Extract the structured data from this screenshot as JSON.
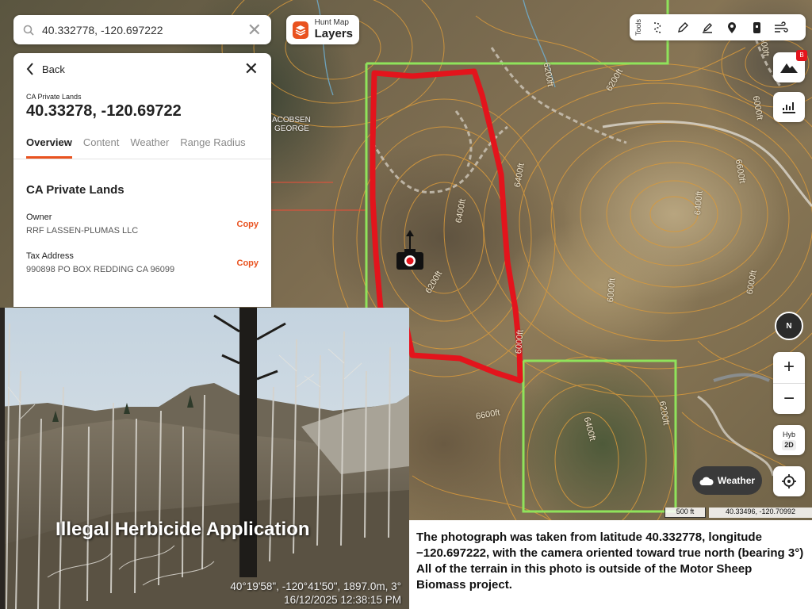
{
  "search": {
    "value": "40.332778, -120.697222"
  },
  "layers_button": {
    "brand": "Hunt Map",
    "label": "Layers"
  },
  "toolbar": {
    "label": "Tools"
  },
  "panel": {
    "back_label": "Back",
    "section_tag": "CA Private Lands",
    "coordinates": "40.33278, -120.69722",
    "tabs": [
      "Overview",
      "Content",
      "Weather",
      "Range Radius"
    ],
    "section_title": "CA Private Lands",
    "fields": [
      {
        "label": "Owner",
        "value": "RRF LASSEN-PLUMAS LLC",
        "action": "Copy"
      },
      {
        "label": "Tax Address",
        "value": "990898 PO BOX REDDING CA 96099",
        "action": "Copy"
      }
    ]
  },
  "map": {
    "place_label_1": "ACOBSEN",
    "place_label_2": "GEORGE",
    "contour_labels": [
      "6200ft",
      "6400ft",
      "6400ft",
      "6600ft",
      "6200ft",
      "6000ft",
      "6400ft",
      "6000ft",
      "6000ft",
      "6600ft",
      "6400ft",
      "6200ft",
      "6600ft",
      "6000ft",
      "6200ft"
    ],
    "boundary_color": "#e3141c",
    "parcel_color": "#8fe35b"
  },
  "controls": {
    "compass": "N",
    "zoom_in": "+",
    "zoom_out": "−",
    "map_type": "Hyb",
    "map_mode": "2D",
    "weather_label": "Weather",
    "layer_badge": "B"
  },
  "scale": {
    "distance": "500 ft",
    "cursor_coords": "40.33496, -120.70992"
  },
  "photo": {
    "title": "Illegal Herbicide Application",
    "stamp_line_1": "40°19'58\", -120°41'50\", 1897.0m, 3°",
    "stamp_line_2": "16/12/2025 12:38:15 PM"
  },
  "caption": "The photograph was taken from latitude 40.332778, longitude −120.697222, with the camera oriented toward true north (bearing 3°) All of the terrain in this photo is outside of the Motor Sheep Biomass project."
}
